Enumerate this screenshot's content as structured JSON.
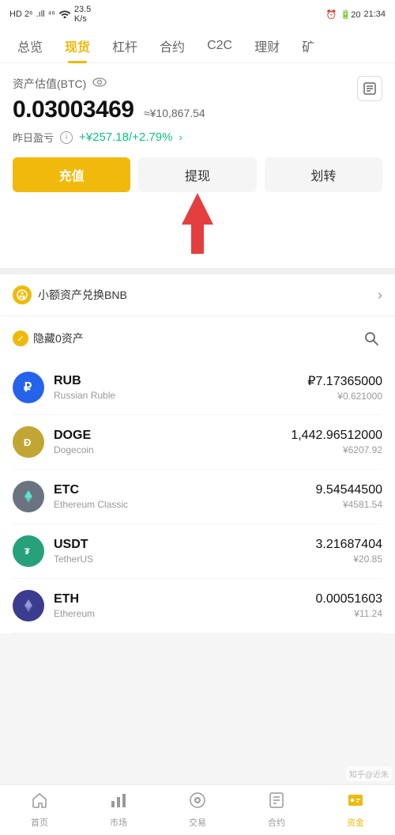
{
  "statusBar": {
    "leftItems": "HD 2⁶ .ıll ⁴⁶",
    "wifi": "WiFi",
    "speed": "23.5 K/s",
    "time": "21:34",
    "battery": "20"
  },
  "navTabs": {
    "items": [
      {
        "id": "overview",
        "label": "总览"
      },
      {
        "id": "spot",
        "label": "现货",
        "active": true
      },
      {
        "id": "leverage",
        "label": "杠杆"
      },
      {
        "id": "contract",
        "label": "合约"
      },
      {
        "id": "c2c",
        "label": "C2C"
      },
      {
        "id": "finance",
        "label": "理财"
      },
      {
        "id": "mining",
        "label": "矿"
      }
    ]
  },
  "assetSection": {
    "label": "资产估值(BTC)",
    "btcValue": "0.03003469",
    "cnyApprox": "≈¥10,867.54",
    "profitLabel": "昨日盈亏",
    "profitValue": "+¥257.18/+2.79%"
  },
  "actionButtons": {
    "deposit": "充值",
    "withdraw": "提现",
    "transfer": "划转"
  },
  "bnbBanner": {
    "text": "小额资产兑换BNB"
  },
  "assetList": {
    "hideZeroLabel": "隐藏0资产",
    "coins": [
      {
        "symbol": "RUB",
        "name": "Russian Ruble",
        "amount": "₽7.17365000",
        "cny": "¥0.621000",
        "iconType": "rub"
      },
      {
        "symbol": "DOGE",
        "name": "Dogecoin",
        "amount": "1,442.96512000",
        "cny": "¥6207.92",
        "iconType": "doge"
      },
      {
        "symbol": "ETC",
        "name": "Ethereum Classic",
        "amount": "9.54544500",
        "cny": "¥4581.54",
        "iconType": "etc"
      },
      {
        "symbol": "USDT",
        "name": "TetherUS",
        "amount": "3.21687404",
        "cny": "¥20.85",
        "iconType": "usdt"
      },
      {
        "symbol": "ETH",
        "name": "Ethereum",
        "amount": "0.00051603",
        "cny": "¥11.24",
        "iconType": "eth"
      }
    ]
  },
  "bottomNav": {
    "items": [
      {
        "id": "home",
        "label": "首页",
        "active": false
      },
      {
        "id": "market",
        "label": "市场",
        "active": false
      },
      {
        "id": "trade",
        "label": "交易",
        "active": false
      },
      {
        "id": "contract",
        "label": "合约",
        "active": false
      },
      {
        "id": "assets",
        "label": "资金",
        "active": true
      }
    ]
  }
}
